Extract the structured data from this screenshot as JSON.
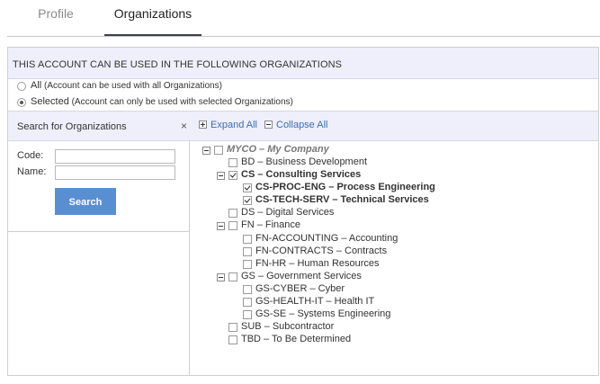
{
  "tabs": [
    {
      "label": "Profile"
    },
    {
      "label": "Organizations"
    }
  ],
  "header": {
    "title": "THIS ACCOUNT CAN BE USED IN THE FOLLOWING ORGANIZATIONS"
  },
  "options": {
    "all": {
      "label": "All",
      "desc": "(Account can be used with all Organizations)"
    },
    "selected": {
      "label": "Selected",
      "desc": "(Account can only be used with selected Organizations)"
    }
  },
  "search": {
    "title": "Search for Organizations",
    "close": "×",
    "code_label": "Code:",
    "name_label": "Name:",
    "button": "Search"
  },
  "tree_controls": {
    "expand": "Expand All",
    "collapse": "Collapse All"
  },
  "tree": {
    "root": "MYCO – My Company",
    "bd": "BD – Business Development",
    "cs": "CS – Consulting Services",
    "cs_proc": "CS-PROC-ENG – Process Engineering",
    "cs_tech": "CS-TECH-SERV – Technical Services",
    "ds": "DS – Digital Services",
    "fn": "FN – Finance",
    "fn_acc": "FN-ACCOUNTING – Accounting",
    "fn_con": "FN-CONTRACTS – Contracts",
    "fn_hr": "FN-HR – Human Resources",
    "gs": "GS – Government Services",
    "gs_cyber": "GS-CYBER – Cyber",
    "gs_health": "GS-HEALTH-IT – Health IT",
    "gs_se": "GS-SE – Systems Engineering",
    "sub": "SUB – Subcontractor",
    "tbd": "TBD – To Be Determined"
  }
}
